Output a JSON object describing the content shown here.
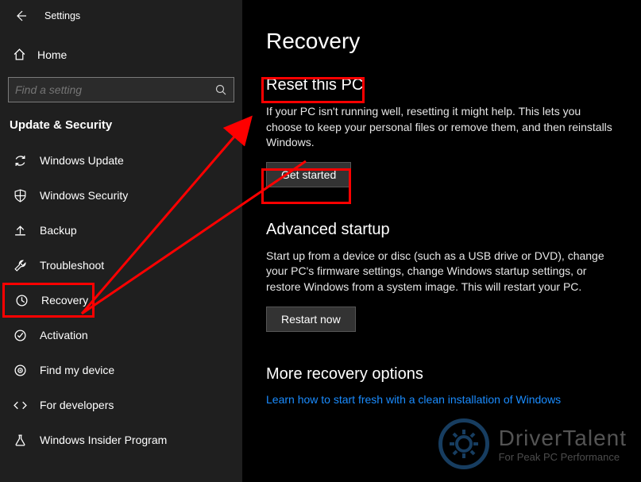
{
  "window": {
    "title": "Settings"
  },
  "sidebar": {
    "home_label": "Home",
    "search_placeholder": "Find a setting",
    "category": "Update & Security",
    "items": [
      {
        "label": "Windows Update",
        "icon": "sync-icon"
      },
      {
        "label": "Windows Security",
        "icon": "shield-icon"
      },
      {
        "label": "Backup",
        "icon": "upload-icon"
      },
      {
        "label": "Troubleshoot",
        "icon": "wrench-icon"
      },
      {
        "label": "Recovery",
        "icon": "history-icon"
      },
      {
        "label": "Activation",
        "icon": "check-circle-icon"
      },
      {
        "label": "Find my device",
        "icon": "locate-icon"
      },
      {
        "label": "For developers",
        "icon": "code-icon"
      },
      {
        "label": "Windows Insider Program",
        "icon": "flask-icon"
      }
    ],
    "selected_index": 4
  },
  "main": {
    "title": "Recovery",
    "sections": {
      "reset": {
        "heading": "Reset this PC",
        "body": "If your PC isn't running well, resetting it might help. This lets you choose to keep your personal files or remove them, and then reinstalls Windows.",
        "button": "Get started"
      },
      "advanced": {
        "heading": "Advanced startup",
        "body": "Start up from a device or disc (such as a USB drive or DVD), change your PC's firmware settings, change Windows startup settings, or restore Windows from a system image. This will restart your PC.",
        "button": "Restart now"
      },
      "more": {
        "heading": "More recovery options",
        "link": "Learn how to start fresh with a clean installation of Windows"
      }
    }
  },
  "watermark": {
    "line1": "DriverTalent",
    "line2": "For Peak PC Performance"
  },
  "annotations": {
    "highlight_color": "#ff0000",
    "boxes": [
      "Reset this PC",
      "Get started",
      "Recovery (sidebar)"
    ],
    "arrow": "from sidebar Recovery to Reset this PC heading"
  }
}
